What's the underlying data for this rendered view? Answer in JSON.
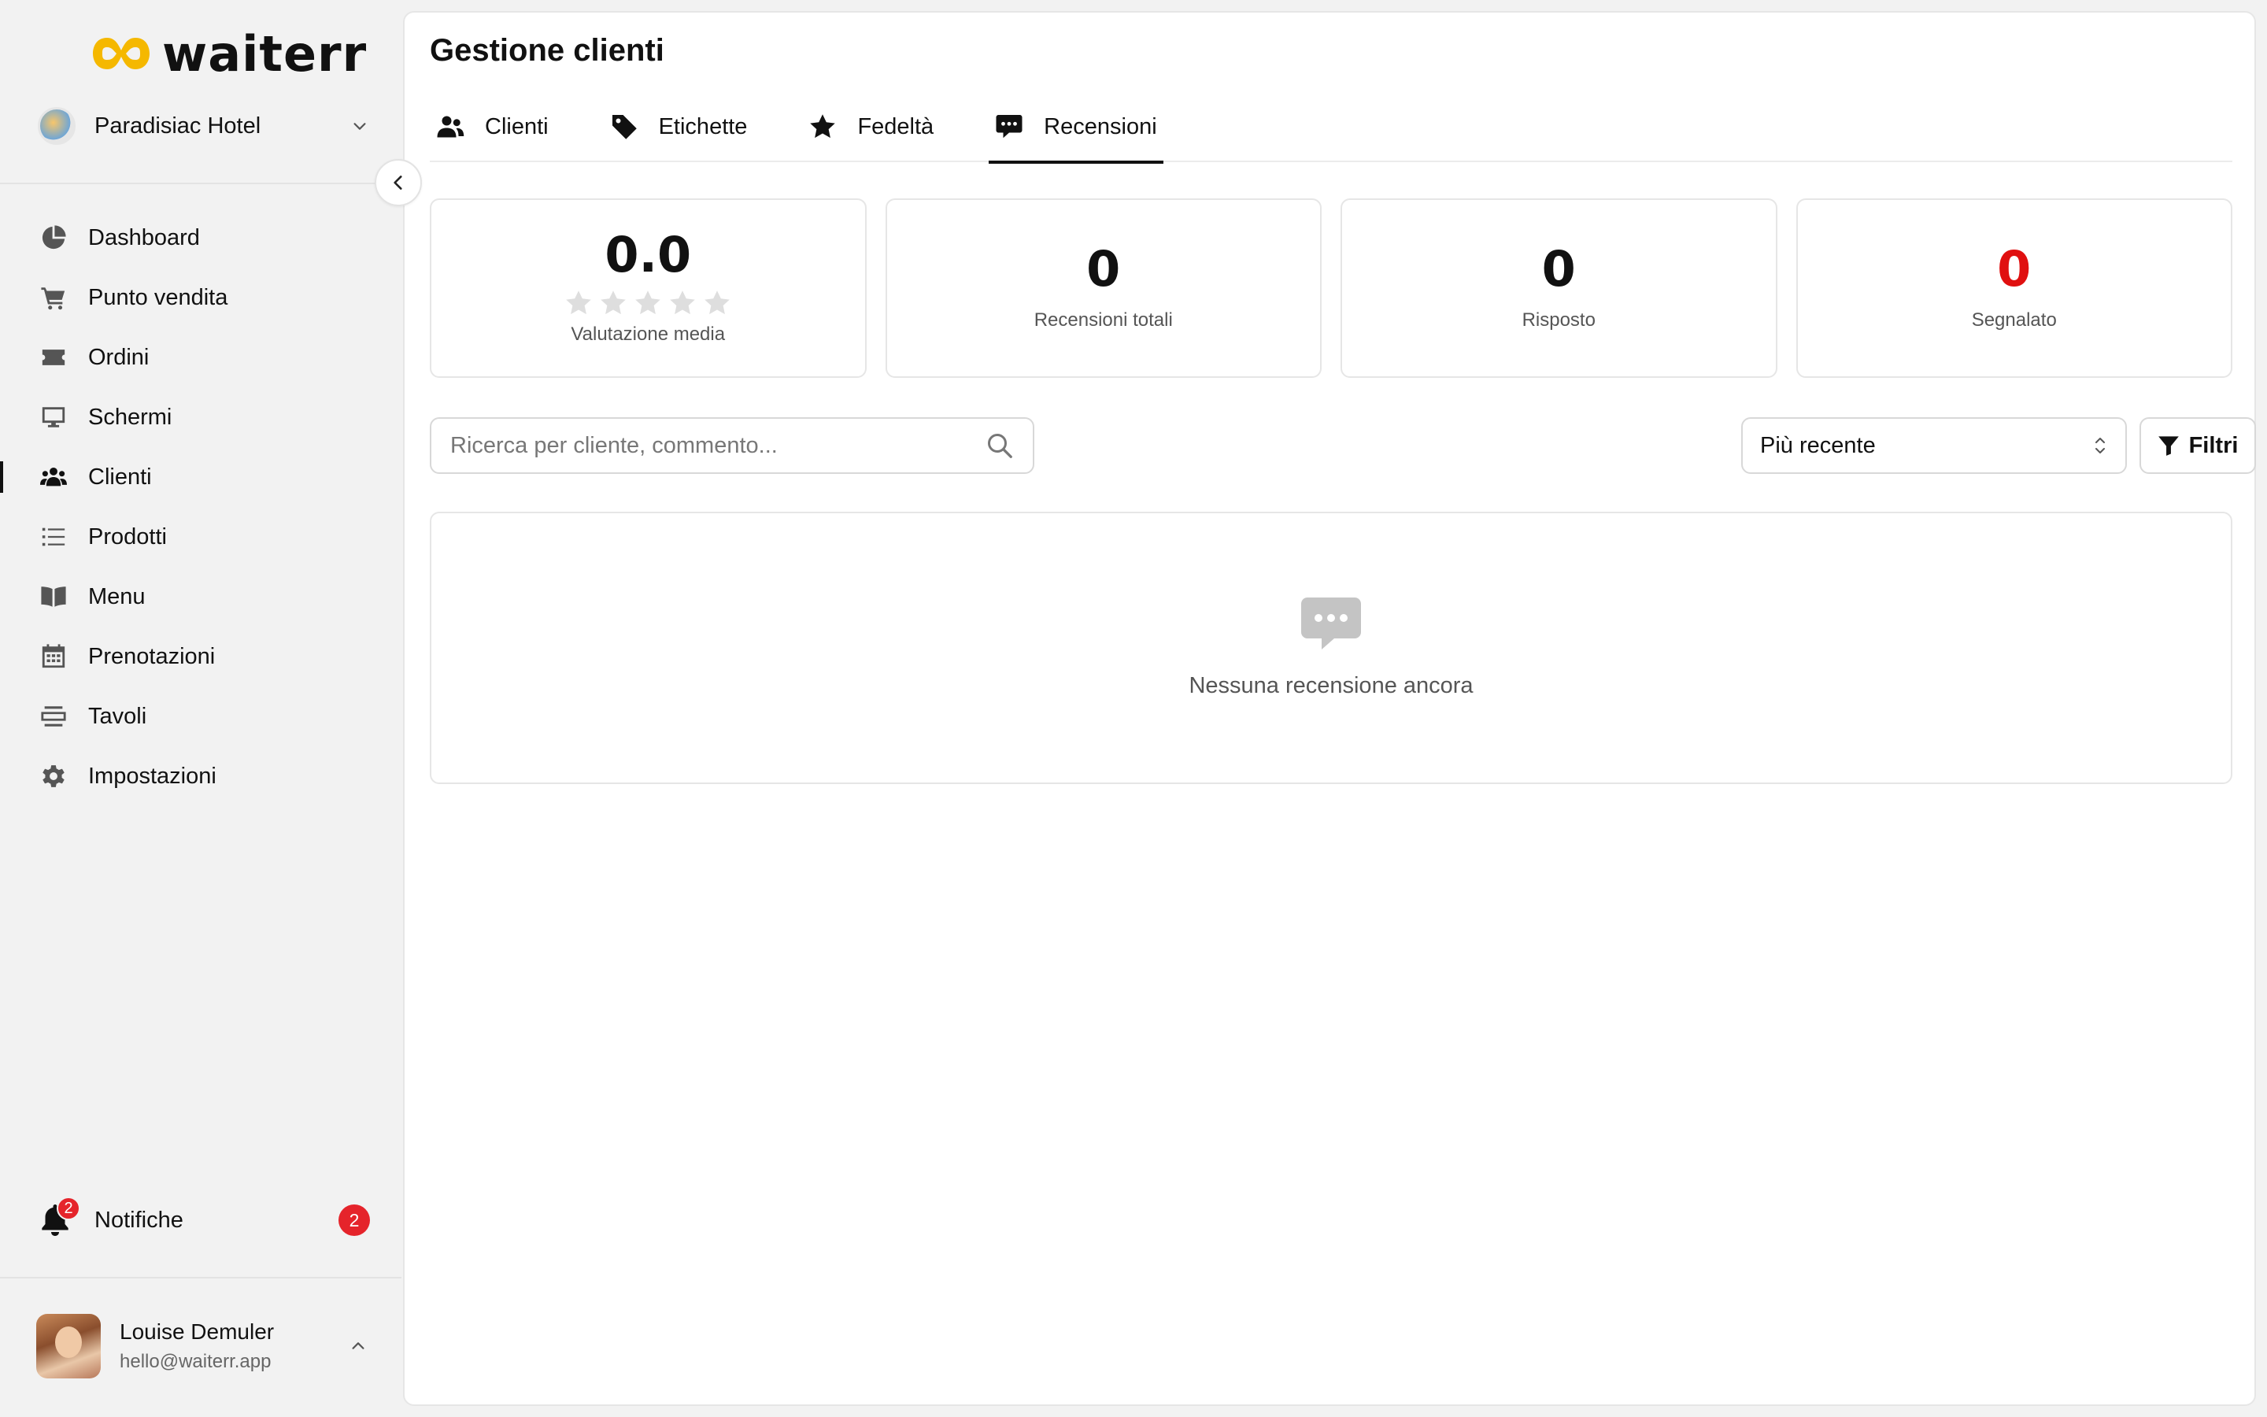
{
  "brand": {
    "name": "waiterr",
    "logo_colors": [
      "#f5b800",
      "#f7d046"
    ]
  },
  "venue": {
    "name": "Paradisiac Hotel",
    "icon": "chevron-down-icon"
  },
  "sidebar": {
    "items": [
      {
        "label": "Dashboard",
        "icon": "pie-chart-icon",
        "active": false
      },
      {
        "label": "Punto vendita",
        "icon": "cart-icon",
        "active": false
      },
      {
        "label": "Ordini",
        "icon": "ticket-icon",
        "active": false
      },
      {
        "label": "Schermi",
        "icon": "monitor-icon",
        "active": false
      },
      {
        "label": "Clienti",
        "icon": "users-icon",
        "active": true
      },
      {
        "label": "Prodotti",
        "icon": "list-icon",
        "active": false
      },
      {
        "label": "Menu",
        "icon": "book-icon",
        "active": false
      },
      {
        "label": "Prenotazioni",
        "icon": "calendar-icon",
        "active": false
      },
      {
        "label": "Tavoli",
        "icon": "table-icon",
        "active": false
      },
      {
        "label": "Impostazioni",
        "icon": "gear-icon",
        "active": false
      }
    ],
    "notifications": {
      "label": "Notifiche",
      "badge": "2",
      "count": "2"
    },
    "user": {
      "name": "Louise Demuler",
      "email": "hello@waiterr.app"
    }
  },
  "page": {
    "title": "Gestione clienti",
    "tabs": [
      {
        "label": "Clienti",
        "icon": "users-icon",
        "active": false
      },
      {
        "label": "Etichette",
        "icon": "tag-icon",
        "active": false
      },
      {
        "label": "Fedeltà",
        "icon": "star-icon",
        "active": false
      },
      {
        "label": "Recensioni",
        "icon": "comment-dots-icon",
        "active": true
      }
    ]
  },
  "stats": {
    "average": {
      "value": "0.0",
      "label": "Valutazione media",
      "stars_filled": 0,
      "stars_total": 5
    },
    "total": {
      "value": "0",
      "label": "Recensioni totali"
    },
    "answered": {
      "value": "0",
      "label": "Risposto"
    },
    "reported": {
      "value": "0",
      "label": "Segnalato",
      "color": "#e01010"
    }
  },
  "toolbar": {
    "search_placeholder": "Ricerca per cliente, commento...",
    "search_value": "",
    "sort_selected": "Più recente",
    "filter_label": "Filtri"
  },
  "empty_state": {
    "message": "Nessuna recensione ancora",
    "icon": "comment-dots-icon"
  }
}
